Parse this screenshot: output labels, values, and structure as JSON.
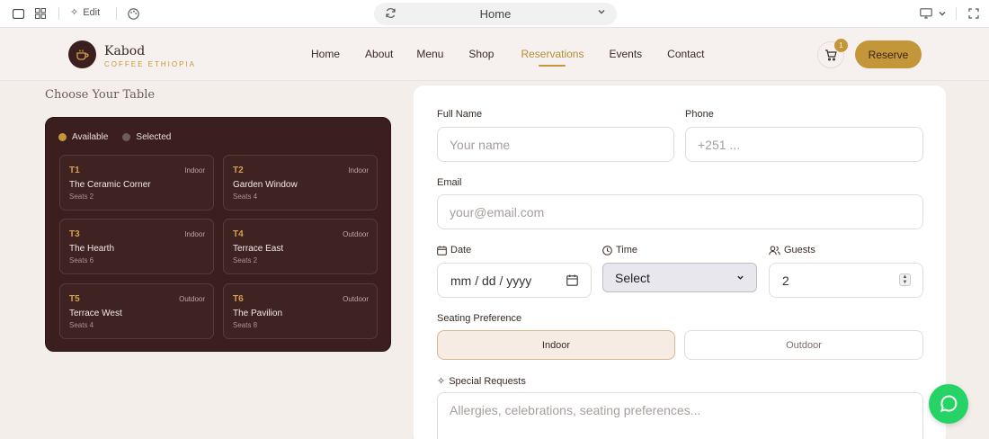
{
  "toolbar": {
    "edit_label": "Edit",
    "address_label": "Home"
  },
  "header": {
    "brand_name": "Kabod",
    "brand_sub": "COFFEE ETHIOPIA",
    "nav": [
      "Home",
      "About",
      "Menu",
      "Shop",
      "Reservations",
      "Events",
      "Contact"
    ],
    "active_nav": "Reservations",
    "cart_count": "1",
    "reserve_label": "Reserve"
  },
  "tables": {
    "title": "Choose Your Table",
    "legend": {
      "available": "Available",
      "selected": "Selected"
    },
    "items": [
      {
        "id": "T1",
        "location": "Indoor",
        "name": "The Ceramic Corner",
        "seats": "Seats 2"
      },
      {
        "id": "T2",
        "location": "Indoor",
        "name": "Garden Window",
        "seats": "Seats 4"
      },
      {
        "id": "T3",
        "location": "Indoor",
        "name": "The Hearth",
        "seats": "Seats 6"
      },
      {
        "id": "T4",
        "location": "Outdoor",
        "name": "Terrace East",
        "seats": "Seats 2"
      },
      {
        "id": "T5",
        "location": "Outdoor",
        "name": "Terrace West",
        "seats": "Seats 4"
      },
      {
        "id": "T6",
        "location": "Outdoor",
        "name": "The Pavilion",
        "seats": "Seats 8"
      }
    ]
  },
  "form": {
    "full_name": {
      "label": "Full Name",
      "placeholder": "Your name"
    },
    "phone": {
      "label": "Phone",
      "placeholder": "+251 ..."
    },
    "email": {
      "label": "Email",
      "placeholder": "your@email.com"
    },
    "date": {
      "label": "Date",
      "placeholder": "mm / dd / yyyy"
    },
    "time": {
      "label": "Time",
      "value": "Select"
    },
    "guests": {
      "label": "Guests",
      "value": "2"
    },
    "seating": {
      "label": "Seating Preference",
      "options": [
        "Indoor",
        "Outdoor"
      ],
      "selected": "Indoor"
    },
    "requests": {
      "label": "Special Requests",
      "placeholder": "Allergies, celebrations, seating preferences..."
    }
  },
  "colors": {
    "accent": "#c4963a",
    "dark_panel": "#3b1e1e",
    "whatsapp": "#25d366"
  }
}
